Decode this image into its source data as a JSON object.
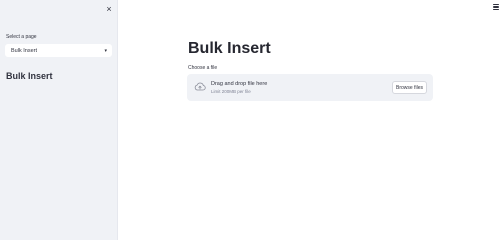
{
  "sidebar": {
    "close_glyph": "×",
    "select_label": "Select a page",
    "select_value": "Bulk Insert",
    "select_caret": "▾",
    "title": "Bulk Insert"
  },
  "main": {
    "title": "Bulk Insert",
    "uploader": {
      "label": "Choose a file",
      "drop_text": "Drag and drop file here",
      "limit_text": "Limit 200MB per file",
      "browse_label": "Browse files"
    }
  },
  "icons": {
    "close": "close-icon",
    "caret": "chevron-down-icon",
    "menu": "hamburger-menu-icon",
    "upload": "cloud-upload-icon"
  },
  "colors": {
    "sidebar_bg": "#f0f2f6",
    "text": "#31333f",
    "muted": "#808495"
  }
}
